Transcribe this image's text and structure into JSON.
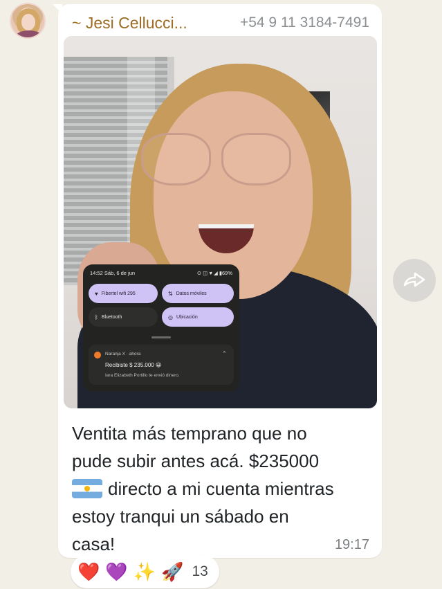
{
  "message": {
    "sender_name": "~ Jesi Cellucci...",
    "sender_phone": "+54 9 11 3184-7491",
    "caption_lines": [
      "Ventita más temprano que no",
      "pude subir antes acá. $235000",
      "directo a mi cuenta mientras",
      "estoy tranqui un sábado en",
      "casa!"
    ],
    "time": "19:17"
  },
  "screenshot": {
    "status_time": "14:52  Sáb, 6 de jun",
    "status_right": "⊙ ◫ ♥ ◢ ▮69%",
    "tiles": {
      "wifi": "Fibertel wifi 295",
      "mobile_data": "Datos móviles",
      "bluetooth": "Bluetooth",
      "location": "Ubicación"
    },
    "notification": {
      "app": "Naranja X · ahora",
      "title": "Recibiste $ 235.000 😀",
      "body": "Iara Elizabeth Portillo te envió dinero."
    }
  },
  "reactions": {
    "emojis": [
      "❤️",
      "💜",
      "✨",
      "🚀"
    ],
    "count": "13"
  },
  "icons": {
    "forward": "forward-icon",
    "flag": "argentina-flag-icon"
  },
  "colors": {
    "chat_background": "#f2efe6",
    "sender_name": "#9c6c24",
    "bubble": "#ffffff",
    "tile_active": "#cfc2f5"
  }
}
